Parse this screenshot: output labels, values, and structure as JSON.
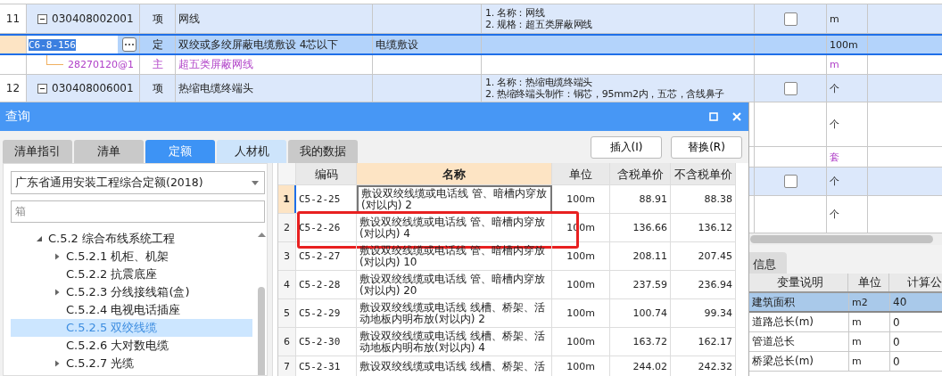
{
  "sheet": {
    "rows": [
      {
        "kind": "item",
        "num": "11",
        "code": "030408002001",
        "type": "项",
        "name": "网线",
        "col_5": "",
        "features": [
          "1. 名称：网线",
          "2. 规格：超五类屏蔽网线"
        ],
        "expanded": true,
        "checked": false,
        "unit": "m",
        "selected": false
      },
      {
        "kind": "quota",
        "num": "",
        "code": "C6-8-156",
        "type": "定",
        "name": "双绞或多绞屏蔽电缆敷设 4芯以下",
        "col_5": "电缆敷设",
        "features": [],
        "unit": "100m",
        "selected": true
      },
      {
        "kind": "material",
        "num": "",
        "code": "28270120@1",
        "type": "主",
        "name": "超五类屏蔽网线",
        "col_5": "",
        "features": [],
        "unit": "m",
        "selected": false
      },
      {
        "kind": "item",
        "num": "12",
        "code": "030408006001",
        "type": "项",
        "name": "热缩电缆终端头",
        "col_5": "",
        "features": [
          "1. 名称：热缩电缆终端头",
          "2. 热缩终端头制作：铜芯，95mm2内，五芯，含线鼻子"
        ],
        "expanded": true,
        "checked": false,
        "unit": "个",
        "selected": false
      }
    ],
    "lower_rows": [
      {
        "kind": "quota",
        "unit": "个"
      },
      {
        "kind": "material",
        "unit": "套"
      },
      {
        "kind": "item",
        "checked": false,
        "unit": "个"
      },
      {
        "kind": "quota",
        "unit": "个"
      }
    ]
  },
  "bottom_panel": {
    "tab": "信息",
    "columns": [
      "变量说明",
      "单位",
      "计算公"
    ],
    "rows": [
      {
        "cells": [
          "建筑面积",
          "m2",
          "40"
        ],
        "selected": true
      },
      {
        "cells": [
          "道路总长(m)",
          "m",
          "0"
        ],
        "selected": false
      },
      {
        "cells": [
          "管道总长",
          "m",
          "0"
        ],
        "selected": false
      },
      {
        "cells": [
          "桥梁总长(m)",
          "m",
          "0"
        ],
        "selected": false
      }
    ]
  },
  "dialog": {
    "title": "查询",
    "tabs": [
      {
        "label": "清单指引",
        "selected": false,
        "hover": false
      },
      {
        "label": "清单",
        "selected": false,
        "hover": false
      },
      {
        "label": "定额",
        "selected": true,
        "hover": false
      },
      {
        "label": "人材机",
        "selected": false,
        "hover": true
      },
      {
        "label": "我的数据",
        "selected": false,
        "hover": false
      }
    ],
    "buttons": [
      "插入(I)",
      "替换(R)"
    ],
    "library": "广东省通用安装工程综合定额(2018)",
    "search": {
      "value": "箱"
    },
    "tree": {
      "items": [
        {
          "label": "C.5.2 综合布线系统工程",
          "kind": "folder",
          "expanded": true,
          "selected": false,
          "children": [
            {
              "label": "C.5.2.1 机柜、机架",
              "kind": "folder",
              "expanded": false,
              "selected": false
            },
            {
              "label": "C.5.2.2 抗震底座",
              "kind": "leaf",
              "selected": false
            },
            {
              "label": "C.5.2.3 分线接线箱(盒)",
              "kind": "folder",
              "expanded": false,
              "selected": false
            },
            {
              "label": "C.5.2.4 电视电话插座",
              "kind": "leaf",
              "selected": false
            },
            {
              "label": "C.5.2.5 双绞线缆",
              "kind": "leaf",
              "selected": true
            },
            {
              "label": "C.5.2.6 大对数电缆",
              "kind": "leaf",
              "selected": false
            },
            {
              "label": "C.5.2.7 光缆",
              "kind": "folder",
              "expanded": false,
              "selected": false
            }
          ]
        }
      ]
    },
    "table": {
      "columns": [
        "编码",
        "名称",
        "单位",
        "含税单价",
        "不含税单价"
      ],
      "rows": [
        {
          "num": "1",
          "cells": [
            "C5-2-25",
            "敷设双绞线缆或电话线 管、暗槽内穿放(对以内) 2",
            "100m",
            "88.91",
            "88.38"
          ],
          "selected": true,
          "highlighted": false
        },
        {
          "num": "2",
          "cells": [
            "C5-2-26",
            "敷设双绞线缆或电话线 管、暗槽内穿放(对以内) 4",
            "100m",
            "136.66",
            "136.12"
          ],
          "selected": false,
          "highlighted": true
        },
        {
          "num": "3",
          "cells": [
            "C5-2-27",
            "敷设双绞线缆或电话线 管、暗槽内穿放(对以内) 10",
            "100m",
            "208.11",
            "207.45"
          ],
          "selected": false,
          "highlighted": false
        },
        {
          "num": "4",
          "cells": [
            "C5-2-28",
            "敷设双绞线缆或电话线 管、暗槽内穿放(对以内) 20",
            "100m",
            "237.59",
            "236.94"
          ],
          "selected": false,
          "highlighted": false
        },
        {
          "num": "5",
          "cells": [
            "C5-2-29",
            "敷设双绞线缆或电话线 线槽、桥架、活动地板内明布放(对以内) 2",
            "100m",
            "100.74",
            "99.34"
          ],
          "selected": false,
          "highlighted": false
        },
        {
          "num": "6",
          "cells": [
            "C5-2-30",
            "敷设双绞线缆或电话线 线槽、桥架、活动地板内明布放(对以内) 4",
            "100m",
            "163.72",
            "162.17"
          ],
          "selected": false,
          "highlighted": false
        },
        {
          "num": "7",
          "cells": [
            "C5-2-31",
            "敷设双绞线缆或电话线 线槽、桥架、活",
            "100m",
            "244.02",
            "242.32"
          ],
          "selected": false,
          "highlighted": false
        }
      ]
    }
  }
}
